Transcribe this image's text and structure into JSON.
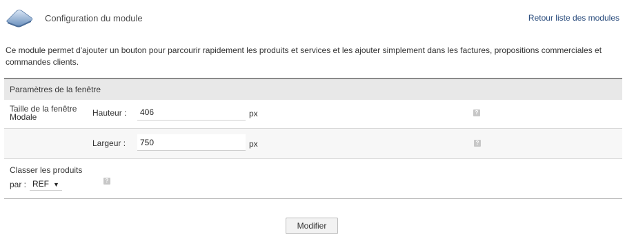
{
  "header": {
    "title": "Configuration du module",
    "back_link": "Retour liste des modules",
    "icon": "module-cloud-icon"
  },
  "description": "Ce module permet d'ajouter un bouton pour parcourir rapidement les produits et services et les ajouter simplement dans les factures, propositions commerciales et commandes clients.",
  "panel": {
    "title": "Paramètres de la fenêtre",
    "modal_size": {
      "label": "Taille de la fenêtre Modale",
      "height_label": "Hauteur :",
      "height_value": "406",
      "width_label": "Largeur :",
      "width_value": "750",
      "unit": "px"
    },
    "sort": {
      "label": "Classer les produits",
      "by_label": "par :",
      "selected": "REF",
      "caret": "▼"
    },
    "help_icon_glyph": "?"
  },
  "actions": {
    "submit_label": "Modifier"
  }
}
